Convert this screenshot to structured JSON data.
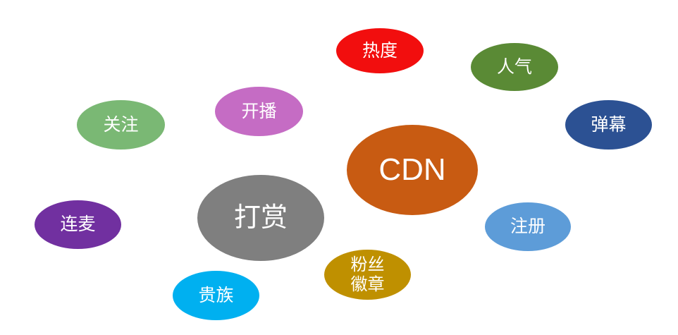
{
  "bubbles": [
    {
      "key": "redu",
      "label": "热度",
      "color": "#f20e0e"
    },
    {
      "key": "renqi",
      "label": "人气",
      "color": "#5a8a35"
    },
    {
      "key": "kaibo",
      "label": "开播",
      "color": "#c56cc4"
    },
    {
      "key": "guanzhu",
      "label": "关注",
      "color": "#7ab874"
    },
    {
      "key": "danmu",
      "label": "弹幕",
      "color": "#2c5193"
    },
    {
      "key": "cdn",
      "label": "CDN",
      "color": "#c85b12"
    },
    {
      "key": "dashang",
      "label": "打赏",
      "color": "#7f7f7f"
    },
    {
      "key": "lianmai",
      "label": "连麦",
      "color": "#7130a0"
    },
    {
      "key": "zhuce",
      "label": "注册",
      "color": "#5d9cd8"
    },
    {
      "key": "fensi",
      "label": "粉丝\n徽章",
      "color": "#bf9000"
    },
    {
      "key": "guizu",
      "label": "贵族",
      "color": "#00b0f0"
    }
  ]
}
